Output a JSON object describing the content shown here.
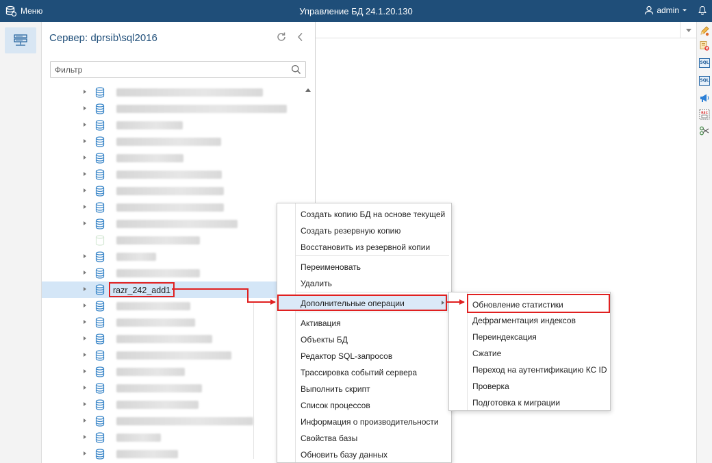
{
  "header": {
    "menu_label": "Меню",
    "app_title": "Управление БД 24.1.20.130",
    "user_name": "admin"
  },
  "panel": {
    "title": "Сервер: dprsib\\sql2016",
    "filter_placeholder": "Фильтр",
    "selected_db_name": "razr_242_add1"
  },
  "context_menu": {
    "group1": [
      "Создать копию БД на основе текущей",
      "Создать резервную копию",
      "Восстановить из резервной копии"
    ],
    "group2": [
      "Переименовать",
      "Удалить"
    ],
    "additional_ops": "Дополнительные операции",
    "group3": [
      "Активация",
      "Объекты БД",
      "Редактор SQL-запросов",
      "Трассировка событий сервера",
      "Выполнить скрипт",
      "Список процессов",
      "Информация о производительности",
      "Свойства базы",
      "Обновить базу данных"
    ]
  },
  "submenu": [
    "Обновление статистики",
    "Дефрагментация индексов",
    "Переиндексация",
    "Сжатие",
    "Переход на аутентификацию КС ID",
    "Проверка",
    "Подготовка к миграции"
  ],
  "right_toolbar": {
    "sql_label": "SQL",
    "rec_label": "REC"
  },
  "colors": {
    "header_bg": "#1f4e79",
    "accent": "#1f4e79",
    "highlight_border": "#e02020",
    "selection_bg": "#d4e6f7"
  }
}
